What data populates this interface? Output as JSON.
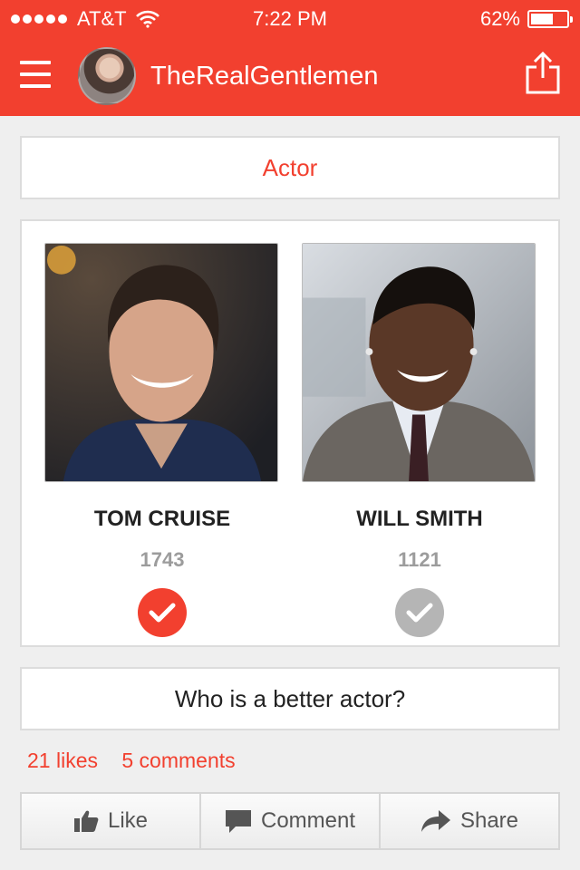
{
  "status_bar": {
    "carrier": "AT&T",
    "time": "7:22 PM",
    "battery_percent": "62%",
    "battery_level": 0.62
  },
  "header": {
    "username": "TheRealGentlemen"
  },
  "poll": {
    "category": "Actor",
    "question": "Who is a better actor?",
    "options": [
      {
        "name": "TOM CRUISE",
        "votes": "1743",
        "selected": true
      },
      {
        "name": "WILL SMITH",
        "votes": "1121",
        "selected": false
      }
    ]
  },
  "engagement": {
    "likes": "21 likes",
    "comments": "5 comments"
  },
  "actions": {
    "like": "Like",
    "comment": "Comment",
    "share": "Share"
  },
  "colors": {
    "accent": "#f2402f",
    "unselected_check": "#b5b5b5"
  }
}
